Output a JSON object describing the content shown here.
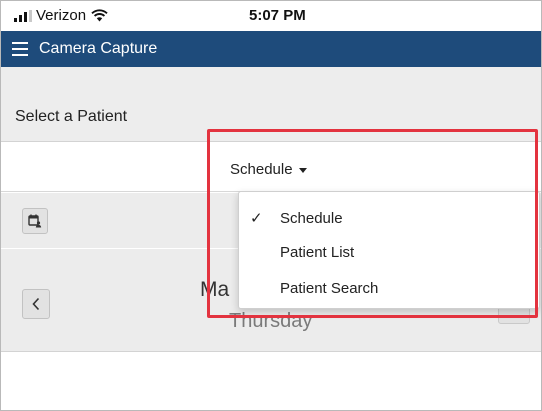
{
  "status_bar": {
    "carrier": "Verizon",
    "time": "5:07 PM"
  },
  "app_bar": {
    "title": "Camera Capture"
  },
  "page": {
    "title": "Select a Patient"
  },
  "view_selector": {
    "selected": "Schedule",
    "options": [
      {
        "label": "Schedule",
        "checked": "✓"
      },
      {
        "label": "Patient List",
        "checked": ""
      },
      {
        "label": "Patient Search",
        "checked": ""
      }
    ]
  },
  "date_nav": {
    "date_partial": "Ma",
    "weekday": "Thursday",
    "prev_glyph": "‹"
  },
  "colors": {
    "app_bar": "#1e4b7b",
    "highlight": "#e3333f"
  }
}
